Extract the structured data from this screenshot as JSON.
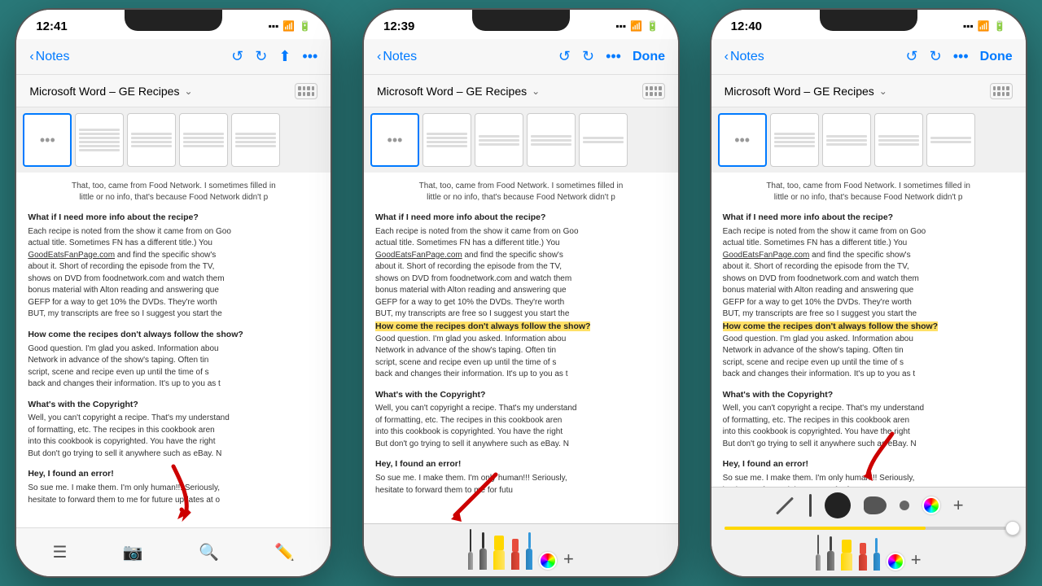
{
  "phones": [
    {
      "id": "phone1",
      "statusBar": {
        "time": "12:41",
        "icons": [
          "signal",
          "wifi",
          "battery"
        ]
      },
      "navBar": {
        "backLabel": "Notes",
        "actions": [
          "rotate-left",
          "rotate-right",
          "share",
          "more"
        ],
        "showDone": false
      },
      "docTitle": "Microsoft Word – GE Recipes",
      "content": {
        "intro": "That, too, came from Food Network. I sometimes filled in\nlittle or no info, that's because Food Network didn't p",
        "sections": [
          {
            "heading": "What if I need more info about the recipe?",
            "text": "Each recipe is noted from the show it came from on Goo\nactual title. Sometimes FN has a different title.) You\nGoodEatsFanPage.com and find the specific show's\nabout it. Short of recording the episode from the TV,\nshows on DVD from foodnetwork.com and watch them\nbonus material with Alton reading and answering que\nGEFP for a way to get 10% the DVDs. They're worth\nBUT, my transcripts are free so I suggest you start the"
          },
          {
            "heading": "How come the recipes don't always follow the show?",
            "highlighted": false,
            "text": "Good question. I'm glad you asked. Information abou\nNetwork in advance of the show's taping. Often tin\nscript, scene and recipe even up until the time of s\nback and changes their information. It's up to you as t"
          },
          {
            "heading": "What's with the Copyright?",
            "text": "Well, you can't copyright a recipe. That's my understand\nof formatting, etc. The recipes in this cookbook aren\ninto this cookbook is copyrighted. You have the right\nBut don't go trying to sell it anywhere such as eBay. N"
          },
          {
            "heading": "Hey, I found an error!",
            "text": "So sue me. I make them. I'm only human!!! Seriously,\nhesitate to forward them to me for future updates at o"
          }
        ]
      },
      "toolbar": {
        "type": "main",
        "icons": [
          "bullet-list",
          "camera",
          "search",
          "pencil"
        ]
      },
      "hasArrow": true,
      "arrowColor": "#cc0000"
    },
    {
      "id": "phone2",
      "statusBar": {
        "time": "12:39",
        "icons": [
          "signal",
          "wifi",
          "battery"
        ]
      },
      "navBar": {
        "backLabel": "Notes",
        "actions": [
          "rotate-left",
          "rotate-right",
          "more"
        ],
        "showDone": true
      },
      "docTitle": "Microsoft Word – GE Recipes",
      "content": {
        "intro": "That, too, came from Food Network. I sometimes filled in\nlittle or no info, that's because Food Network didn't p",
        "sections": [
          {
            "heading": "What if I need more info about the recipe?",
            "text": "Each recipe is noted from the show it came from on Goo\nactual title. Sometimes FN has a different title.) You\nGoodEatsFanPage.com and find the specific show's\nabout it. Short of recording the episode from the TV,\nshows on DVD from foodnetwork.com and watch them\nbonus material with Alton reading and answering que\nGEFP for a way to get 10% the DVDs. They're worth\nBUT, my transcripts are free so I suggest you start the"
          },
          {
            "heading": "How come the recipes don't always follow the show?",
            "highlighted": true,
            "text": "Good question. I'm glad you asked. Information abou\nNetwork in advance of the show's taping. Often tin\nscript, scene and recipe even up until the time of s\nback and changes their information. It's up to you as t"
          },
          {
            "heading": "What's with the Copyright?",
            "text": "Well, you can't copyright a recipe. That's my understand\nof formatting, etc. The recipes in this cookbook aren\ninto this cookbook is copyrighted. You have the right\nBut don't go trying to sell it anywhere such as eBay. N"
          },
          {
            "heading": "Hey, I found an error!",
            "text": "So sue me. I make them. I'm only human!!! Seriously,\nhesitate to forward them to me for futu"
          }
        ]
      },
      "toolbar": {
        "type": "pen",
        "tools": [
          "thin-pen",
          "pen",
          "highlighter-yellow",
          "eraser-red",
          "pen-blue",
          "color-wheel",
          "plus"
        ]
      },
      "hasArrow": true,
      "arrowColor": "#cc0000"
    },
    {
      "id": "phone3",
      "statusBar": {
        "time": "12:40",
        "icons": [
          "signal",
          "wifi",
          "battery"
        ]
      },
      "navBar": {
        "backLabel": "Notes",
        "actions": [
          "rotate-left",
          "rotate-right",
          "more"
        ],
        "showDone": true
      },
      "docTitle": "Microsoft Word – GE Recipes",
      "content": {
        "intro": "That, too, came from Food Network. I sometimes filled in\nlittle or no info, that's because Food Network didn't p",
        "sections": [
          {
            "heading": "What if I need more info about the recipe?",
            "text": "Each recipe is noted from the show it came from on Goo\nactual title. Sometimes FN has a different title.) You\nGoodEatsFanPage.com and find the specific show's\nabout it. Short of recording the episode from the TV,\nshows on DVD from foodnetwork.com and watch them\nbonus material with Alton reading and answering que\nGEFP for a way to get 10% the DVDs. They're worth\nBUT, my transcripts are free so I suggest you start the"
          },
          {
            "heading": "How come the recipes don't always follow the show?",
            "highlighted": true,
            "text": "Good question. I'm glad you asked. Information abou\nNetwork in advance of the show's taping. Often tin\nscript, scene and recipe even up until the time of s\nback and changes their information. It's up to you as t"
          },
          {
            "heading": "What's with the Copyright?",
            "text": "Well, you can't copyright a recipe. That's my understand\nof formatting, etc. The recipes in this cookbook aren\ninto this cookbook is copyrighted. You have the right\nBut don't go trying to sell it anywhere such as eBay. N"
          },
          {
            "heading": "Hey, I found an error!",
            "text": "So sue me. I make them. I'm only human!!! Seriously,\nhesitate to forward them to me for fu"
          }
        ]
      },
      "toolbar": {
        "type": "eraser",
        "tools": [
          "diagonal-line",
          "pen-thin",
          "eraser-round",
          "blob",
          "dot",
          "color-wheel",
          "plus"
        ]
      },
      "hasArrow": true,
      "arrowColor": "#cc0000"
    }
  ]
}
